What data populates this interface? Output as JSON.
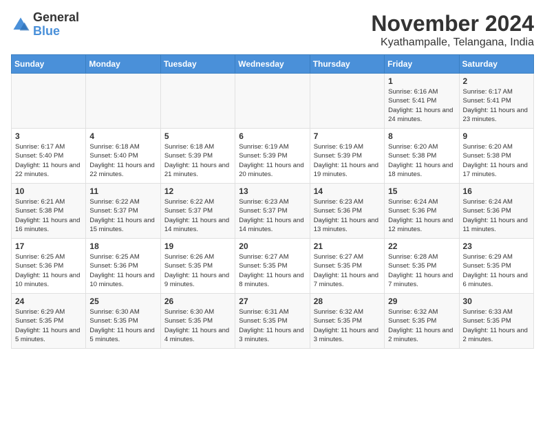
{
  "logo": {
    "general": "General",
    "blue": "Blue"
  },
  "title": "November 2024",
  "subtitle": "Kyathampalle, Telangana, India",
  "days_of_week": [
    "Sunday",
    "Monday",
    "Tuesday",
    "Wednesday",
    "Thursday",
    "Friday",
    "Saturday"
  ],
  "weeks": [
    [
      {
        "day": "",
        "info": ""
      },
      {
        "day": "",
        "info": ""
      },
      {
        "day": "",
        "info": ""
      },
      {
        "day": "",
        "info": ""
      },
      {
        "day": "",
        "info": ""
      },
      {
        "day": "1",
        "info": "Sunrise: 6:16 AM\nSunset: 5:41 PM\nDaylight: 11 hours and 24 minutes."
      },
      {
        "day": "2",
        "info": "Sunrise: 6:17 AM\nSunset: 5:41 PM\nDaylight: 11 hours and 23 minutes."
      }
    ],
    [
      {
        "day": "3",
        "info": "Sunrise: 6:17 AM\nSunset: 5:40 PM\nDaylight: 11 hours and 22 minutes."
      },
      {
        "day": "4",
        "info": "Sunrise: 6:18 AM\nSunset: 5:40 PM\nDaylight: 11 hours and 22 minutes."
      },
      {
        "day": "5",
        "info": "Sunrise: 6:18 AM\nSunset: 5:39 PM\nDaylight: 11 hours and 21 minutes."
      },
      {
        "day": "6",
        "info": "Sunrise: 6:19 AM\nSunset: 5:39 PM\nDaylight: 11 hours and 20 minutes."
      },
      {
        "day": "7",
        "info": "Sunrise: 6:19 AM\nSunset: 5:39 PM\nDaylight: 11 hours and 19 minutes."
      },
      {
        "day": "8",
        "info": "Sunrise: 6:20 AM\nSunset: 5:38 PM\nDaylight: 11 hours and 18 minutes."
      },
      {
        "day": "9",
        "info": "Sunrise: 6:20 AM\nSunset: 5:38 PM\nDaylight: 11 hours and 17 minutes."
      }
    ],
    [
      {
        "day": "10",
        "info": "Sunrise: 6:21 AM\nSunset: 5:38 PM\nDaylight: 11 hours and 16 minutes."
      },
      {
        "day": "11",
        "info": "Sunrise: 6:22 AM\nSunset: 5:37 PM\nDaylight: 11 hours and 15 minutes."
      },
      {
        "day": "12",
        "info": "Sunrise: 6:22 AM\nSunset: 5:37 PM\nDaylight: 11 hours and 14 minutes."
      },
      {
        "day": "13",
        "info": "Sunrise: 6:23 AM\nSunset: 5:37 PM\nDaylight: 11 hours and 14 minutes."
      },
      {
        "day": "14",
        "info": "Sunrise: 6:23 AM\nSunset: 5:36 PM\nDaylight: 11 hours and 13 minutes."
      },
      {
        "day": "15",
        "info": "Sunrise: 6:24 AM\nSunset: 5:36 PM\nDaylight: 11 hours and 12 minutes."
      },
      {
        "day": "16",
        "info": "Sunrise: 6:24 AM\nSunset: 5:36 PM\nDaylight: 11 hours and 11 minutes."
      }
    ],
    [
      {
        "day": "17",
        "info": "Sunrise: 6:25 AM\nSunset: 5:36 PM\nDaylight: 11 hours and 10 minutes."
      },
      {
        "day": "18",
        "info": "Sunrise: 6:25 AM\nSunset: 5:36 PM\nDaylight: 11 hours and 10 minutes."
      },
      {
        "day": "19",
        "info": "Sunrise: 6:26 AM\nSunset: 5:35 PM\nDaylight: 11 hours and 9 minutes."
      },
      {
        "day": "20",
        "info": "Sunrise: 6:27 AM\nSunset: 5:35 PM\nDaylight: 11 hours and 8 minutes."
      },
      {
        "day": "21",
        "info": "Sunrise: 6:27 AM\nSunset: 5:35 PM\nDaylight: 11 hours and 7 minutes."
      },
      {
        "day": "22",
        "info": "Sunrise: 6:28 AM\nSunset: 5:35 PM\nDaylight: 11 hours and 7 minutes."
      },
      {
        "day": "23",
        "info": "Sunrise: 6:29 AM\nSunset: 5:35 PM\nDaylight: 11 hours and 6 minutes."
      }
    ],
    [
      {
        "day": "24",
        "info": "Sunrise: 6:29 AM\nSunset: 5:35 PM\nDaylight: 11 hours and 5 minutes."
      },
      {
        "day": "25",
        "info": "Sunrise: 6:30 AM\nSunset: 5:35 PM\nDaylight: 11 hours and 5 minutes."
      },
      {
        "day": "26",
        "info": "Sunrise: 6:30 AM\nSunset: 5:35 PM\nDaylight: 11 hours and 4 minutes."
      },
      {
        "day": "27",
        "info": "Sunrise: 6:31 AM\nSunset: 5:35 PM\nDaylight: 11 hours and 3 minutes."
      },
      {
        "day": "28",
        "info": "Sunrise: 6:32 AM\nSunset: 5:35 PM\nDaylight: 11 hours and 3 minutes."
      },
      {
        "day": "29",
        "info": "Sunrise: 6:32 AM\nSunset: 5:35 PM\nDaylight: 11 hours and 2 minutes."
      },
      {
        "day": "30",
        "info": "Sunrise: 6:33 AM\nSunset: 5:35 PM\nDaylight: 11 hours and 2 minutes."
      }
    ]
  ]
}
